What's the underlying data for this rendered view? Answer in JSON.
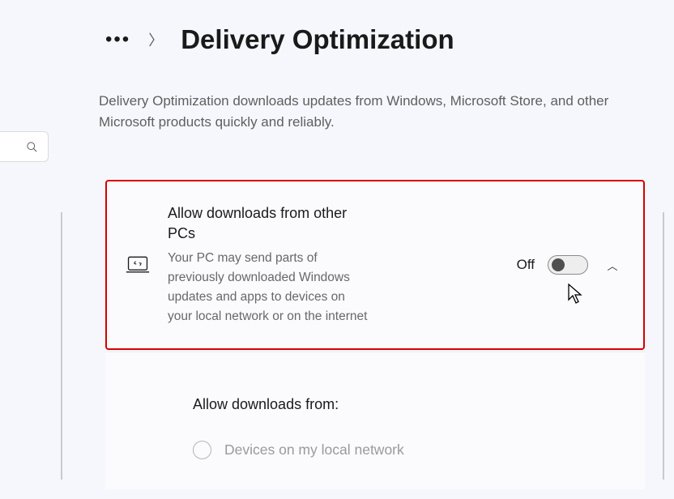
{
  "breadcrumb": {
    "title": "Delivery Optimization"
  },
  "description": "Delivery Optimization downloads updates from Windows, Microsoft Store, and other Microsoft products quickly and reliably.",
  "allowCard": {
    "title": "Allow downloads from other PCs",
    "subtitle": "Your PC may send parts of previously downloaded Windows updates and apps to devices on your local network or on the internet",
    "toggleState": "Off"
  },
  "allowFrom": {
    "title": "Allow downloads from:",
    "options": [
      {
        "label": "Devices on my local network"
      }
    ]
  }
}
